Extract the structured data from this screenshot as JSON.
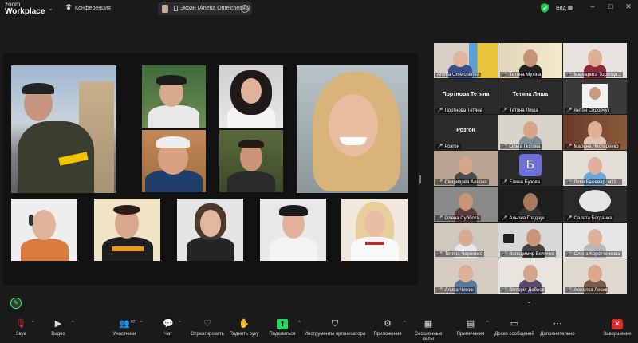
{
  "app": {
    "logo_line1": "zoom",
    "logo_line2": "Workplace"
  },
  "topbar": {
    "conference_label": "Конференция",
    "share_label": "Экран (Anetta Omelchenko)",
    "view_label": "Вид",
    "window_controls": [
      "minimize-icon",
      "maximize-icon",
      "close-icon"
    ]
  },
  "gallery": {
    "participants": [
      {
        "name": "Anetta Omelchenko",
        "muted": false,
        "video": true,
        "active": true
      },
      {
        "name": "Тетяна Мухіна",
        "muted": true,
        "video": true
      },
      {
        "name": "Маргарита Торопцо...",
        "muted": true,
        "video": true
      },
      {
        "name": "Портнова Тетяна",
        "display_name": "Портнова Тетяна",
        "muted": true,
        "video": false
      },
      {
        "name": "Тетяна Лиша",
        "display_name": "Тетяна Лиша",
        "muted": true,
        "video": false
      },
      {
        "name": "Антон Сидорчук",
        "muted": true,
        "video": true
      },
      {
        "name": "Розгон",
        "display_name": "Розгон",
        "muted": true,
        "video": false
      },
      {
        "name": "Ольга Попова",
        "muted": true,
        "video": true
      },
      {
        "name": "Марина Нестеренко",
        "muted": true,
        "video": true
      },
      {
        "name": "Свиридова Альона",
        "muted": true,
        "video": true
      },
      {
        "name": "Елена Бузова",
        "avatar_letter": "Б",
        "muted": true,
        "video": false
      },
      {
        "name": "Лілія Бежевар_м11...",
        "muted": true,
        "video": true
      },
      {
        "name": "Олена Субботa",
        "muted": true,
        "video": true
      },
      {
        "name": "Альона Гладчук",
        "muted": true,
        "video": true
      },
      {
        "name": "Салата Богданна",
        "muted": true,
        "video": true
      },
      {
        "name": "Тетяна Черненко",
        "muted": true,
        "video": true
      },
      {
        "name": "Володимир Величко",
        "muted": true,
        "video": true
      },
      {
        "name": "Олена Коротченкова",
        "muted": true,
        "video": true
      },
      {
        "name": "Алиса Чижик",
        "muted": true,
        "video": true
      },
      {
        "name": "Вікторія Добнок",
        "muted": true,
        "video": true
      },
      {
        "name": "Анжелка Лесик",
        "muted": true,
        "video": true
      }
    ]
  },
  "toolbar": {
    "items": [
      {
        "label": "Звук",
        "icon": "mic-muted-icon"
      },
      {
        "label": "Видео",
        "icon": "video-camera-icon"
      },
      {
        "label": "Участники",
        "icon": "participants-icon",
        "count": "67"
      },
      {
        "label": "Чат",
        "icon": "chat-icon"
      },
      {
        "label": "Отреагировать",
        "icon": "heart-icon"
      },
      {
        "label": "Поднять руку",
        "icon": "hand-icon"
      },
      {
        "label": "Поделиться",
        "icon": "share-screen-icon",
        "color": "#23d95d"
      },
      {
        "label": "Инструменты организатора",
        "icon": "shield-icon"
      },
      {
        "label": "Приложения",
        "icon": "apps-icon"
      },
      {
        "label": "Сессионные залы",
        "icon": "breakout-rooms-icon"
      },
      {
        "label": "Примечания",
        "icon": "notes-icon"
      },
      {
        "label": "Доски сообщений",
        "icon": "whiteboard-icon"
      },
      {
        "label": "Дополнительно",
        "icon": "more-icon"
      },
      {
        "label": "Завершение",
        "icon": "end-icon",
        "color": "#e02828"
      }
    ]
  }
}
